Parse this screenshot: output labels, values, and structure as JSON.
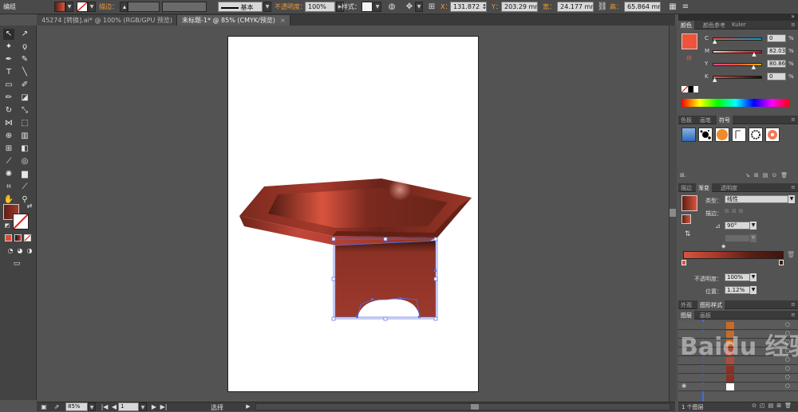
{
  "control_bar": {
    "group_label": "编组",
    "stroke_label": "描边：",
    "stroke_style": "基本",
    "opacity_label": "不透明度：",
    "opacity_value": "100%",
    "style_label": "样式：",
    "x_label": "X：",
    "x_value": "131.872 ↕",
    "y_label": "Y：",
    "y_value": "203.29 mm",
    "w_label": "宽：",
    "w_value": "24.177 mm",
    "h_label": "高：",
    "h_value": "65.864 mm"
  },
  "tabs": [
    {
      "label": "45274 [转换].ai* @ 100% (RGB/GPU 预览)",
      "active": false
    },
    {
      "label": "未标题-1* @ 85% (CMYK/预览)",
      "active": true
    }
  ],
  "status_bar": {
    "zoom": "85%",
    "page": "1",
    "tool_status": "选择"
  },
  "color_panel": {
    "tabs": [
      "颜色",
      "颜色参考",
      "Kuler"
    ],
    "channels": [
      {
        "label": "C",
        "value": "0",
        "unit": "%",
        "fill": 0.0
      },
      {
        "label": "M",
        "value": "82.03",
        "unit": "%",
        "fill": 0.82
      },
      {
        "label": "Y",
        "value": "80.86",
        "unit": "%",
        "fill": 0.81
      },
      {
        "label": "K",
        "value": "0",
        "unit": "%",
        "fill": 0.0
      }
    ]
  },
  "symbols_panel": {
    "tabs": [
      "色板",
      "画笔",
      "符号"
    ]
  },
  "gradient_panel": {
    "tabs": [
      "描边",
      "渐变",
      "透明度"
    ],
    "type_label": "类型：",
    "type_value": "线性",
    "stroke_label": "描边：",
    "angle_value": "90°",
    "opacity_label": "不透明度：",
    "opacity_value": "100%",
    "location_label": "位置：",
    "location_value": "1.12%"
  },
  "appearance_panel": {
    "tabs": [
      "外观",
      "图形样式"
    ]
  },
  "layers_panel": {
    "tabs": [
      "图层",
      "画板"
    ],
    "layer_count": "1 个图层"
  },
  "colors": {
    "fill_swatch": "#f0533b",
    "gradient_dark": "#5c1f16",
    "gradient_mid": "#a5392a",
    "gradient_light": "#d9543f",
    "selection": "#5a6de0"
  },
  "watermark": "Baidu 经验"
}
